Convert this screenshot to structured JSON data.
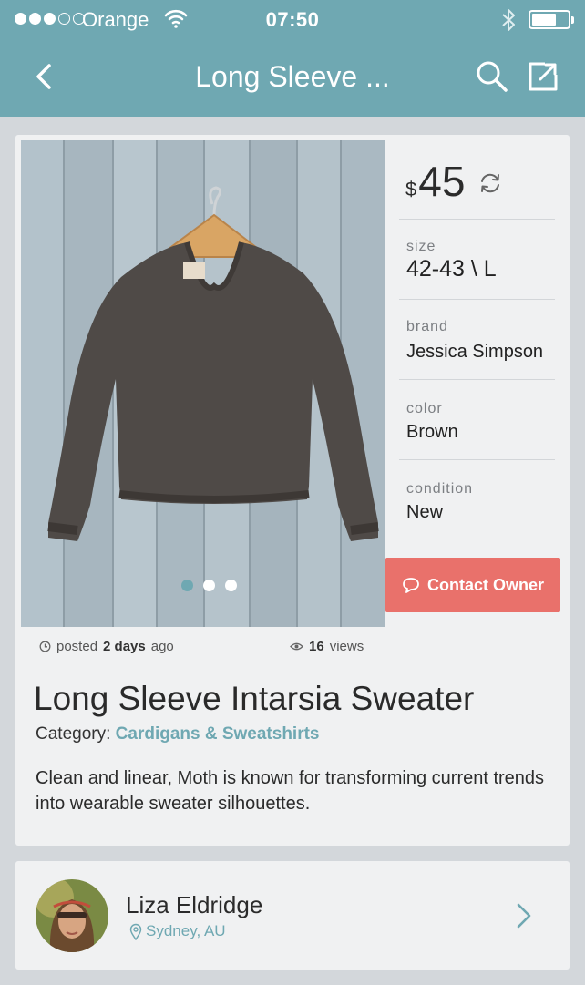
{
  "status_bar": {
    "carrier": "Orange",
    "time": "07:50"
  },
  "nav": {
    "title": "Long Sleeve ...",
    "icons": [
      "chevron-left-icon",
      "search-icon",
      "share-icon"
    ]
  },
  "product": {
    "currency": "$",
    "price": "45",
    "specs": [
      {
        "label": "size",
        "value": "42-43 \\ L"
      },
      {
        "label": "brand",
        "value": "Jessica Simpson"
      },
      {
        "label": "color",
        "value": "Brown"
      },
      {
        "label": "condition",
        "value": "New"
      }
    ],
    "contact_label": "Contact Owner",
    "posted_prefix": "posted",
    "posted_when": "2 days",
    "posted_suffix": "ago",
    "views_count": "16",
    "views_label": "views",
    "title": "Long Sleeve Intarsia Sweater",
    "category_label": "Category:",
    "category": "Cardigans & Sweatshirts",
    "description": "Clean and linear, Moth is known for transforming current trends into wearable sweater silhouettes.",
    "image_count": 3,
    "active_image": 1
  },
  "seller": {
    "name": "Liza Eldridge",
    "location": "Sydney, AU"
  },
  "colors": {
    "accent": "#6fa8b2",
    "contact_button": "#e9716b",
    "background": "#d3d7db",
    "card": "#f0f1f2"
  }
}
